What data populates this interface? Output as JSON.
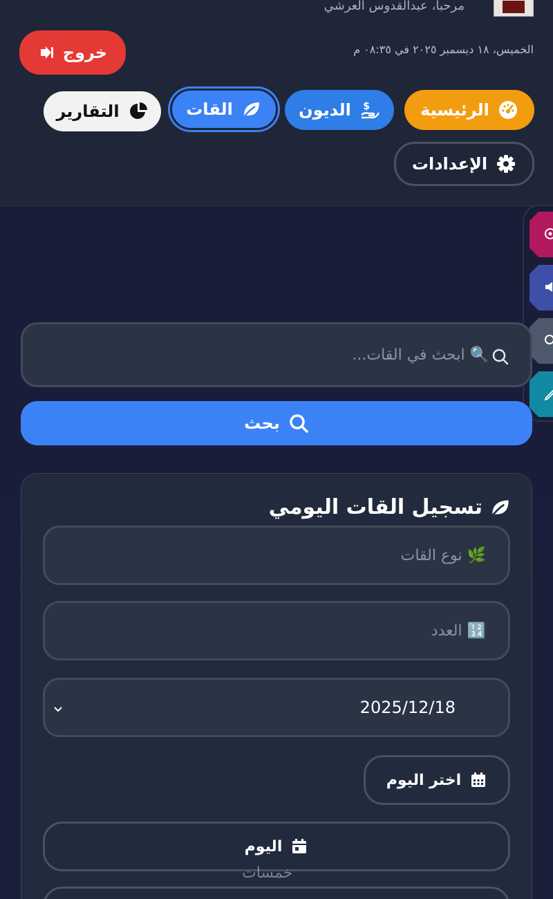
{
  "header": {
    "welcome": "مرحبا، عبدالقدوس العرشي",
    "datetime": "الخميس، ١٨ ديسمبر ٢٠٢٥ في ٠٨:٣٥ م",
    "logout_label": "خروج"
  },
  "nav": {
    "home": "الرئيسية",
    "debts": "الديون",
    "qat": "القات",
    "reports": "التقارير",
    "settings": "الإعدادات"
  },
  "search": {
    "placeholder": "🔍 ابحث في القات...",
    "button_label": "بحث"
  },
  "form": {
    "title": "تسجيل القات اليومي",
    "type_placeholder": "🌿 نوع القات",
    "count_placeholder": "🔢 العدد",
    "date_value": "2025/12/18",
    "choose_day_label": "اختر اليوم",
    "today_label": "اليوم"
  },
  "watermark": "خمسات",
  "colors": {
    "home": "#f29c0f",
    "debts": "#2f7de6",
    "qat_active": "#3b82f6",
    "logout": "#e53935",
    "side_tabs": [
      "#b2185e",
      "#3f4fa8",
      "#4f596e",
      "#138aa3"
    ]
  }
}
